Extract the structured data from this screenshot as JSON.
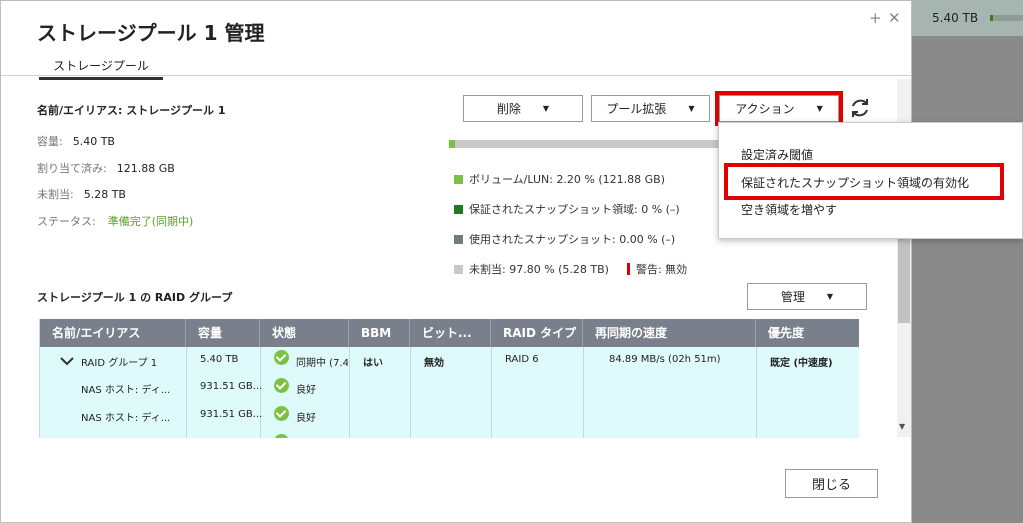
{
  "background": {
    "capacity_value": "5.40 TB"
  },
  "dialog": {
    "title": "ストレージプール 1 管理",
    "tab": "ストレージプール",
    "name_line": "名前/エイリアス: ストレージプール 1",
    "capacity_label": "容量:",
    "capacity_value": "5.40 TB",
    "allocated_label": "割り当て済み:",
    "allocated_value": "121.88 GB",
    "unallocated_label": "未割当:",
    "unallocated_value": "5.28 TB",
    "status_label": "ステータス:",
    "status_value": "準備完了(同期中)"
  },
  "toolbar": {
    "delete_label": "削除",
    "expand_label": "プール拡張",
    "action_label": "アクション",
    "caret": "▼"
  },
  "usage": {
    "used_fraction": 0.022,
    "legend": [
      {
        "text": "ボリューム/LUN: 2.20 % (121.88 GB)",
        "color": "#7cc144"
      },
      {
        "text": "保証されたスナップショット領域: 0 % (–)",
        "color": "#1f7a1f"
      },
      {
        "text": "使用されたスナップショット: 0.00 % (–)",
        "color": "#6f7c78"
      },
      {
        "text": "未割当: 97.80 % (5.28 TB)",
        "color": "#c8c8c8"
      }
    ],
    "warning_text": "警告: 無効",
    "warning_color": "#e00000"
  },
  "action_menu": {
    "items": [
      "設定済み閾値",
      "保証されたスナップショット領域の有効化",
      "空き領域を増やす"
    ]
  },
  "raid": {
    "title": "ストレージプール 1 の RAID グループ",
    "manage_label": "管理",
    "columns": [
      "名前/エイリアス",
      "容量",
      "状態",
      "BBM",
      "ビット...",
      "RAID タイプ",
      "再同期の速度",
      "優先度"
    ],
    "group": {
      "name": "RAID グループ 1",
      "capacity": "5.40 TB",
      "status": "同期中 (7.4",
      "bbm": "はい",
      "bitmap": "無効",
      "raid_type": "RAID 6",
      "speed": "84.89 MB/s (02h 51m)",
      "priority": "既定 (中速度)"
    },
    "disks": [
      {
        "name": "NAS ホスト: ディ...",
        "capacity": "931.51 GB...",
        "status": "良好"
      },
      {
        "name": "NAS ホスト: ディ...",
        "capacity": "931.51 GB...",
        "status": "良好"
      }
    ]
  },
  "footer": {
    "close_label": "閉じる"
  },
  "window": {
    "add_glyph": "+",
    "close_glyph": "✕"
  }
}
